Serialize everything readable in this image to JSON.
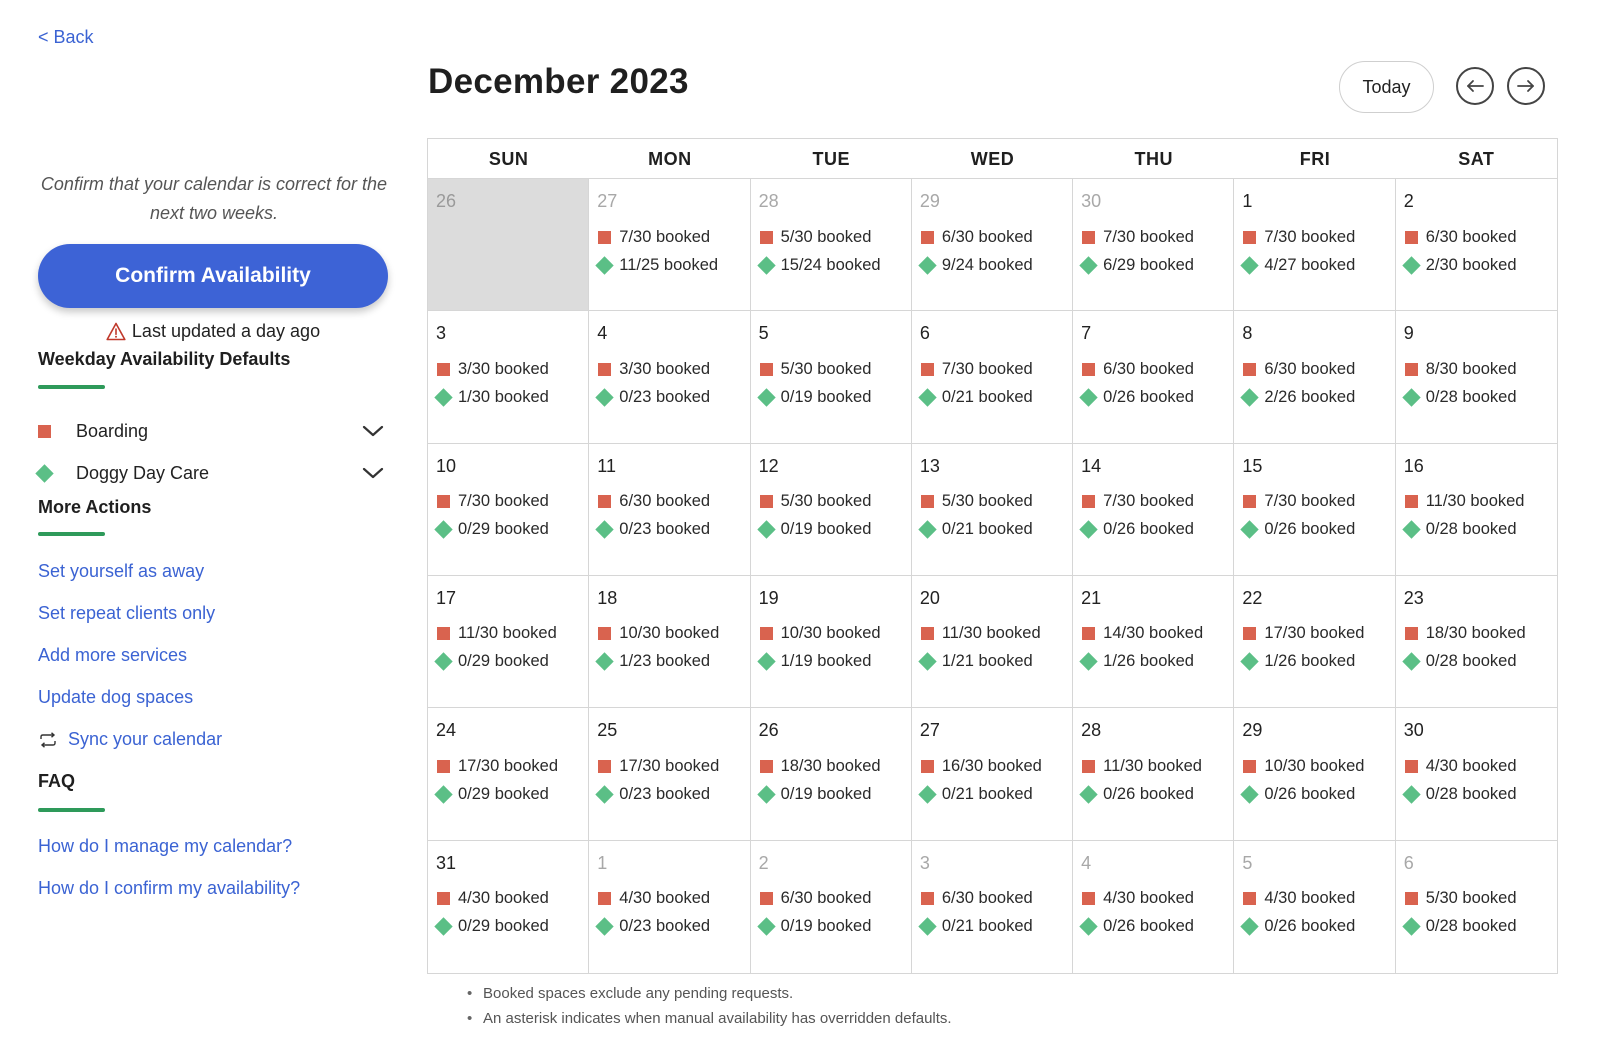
{
  "nav": {
    "back_label": "< Back"
  },
  "sidebar": {
    "confirm_text": "Confirm that your calendar is correct for the next two weeks.",
    "confirm_button": "Confirm Availability",
    "last_updated": "Last updated a day ago",
    "weekday_title": "Weekday Availability Defaults",
    "services": [
      {
        "label": "Boarding",
        "marker": "square",
        "color": "#d9634f"
      },
      {
        "label": "Doggy Day Care",
        "marker": "diamond",
        "color": "#5bbf86"
      }
    ],
    "more_actions_title": "More Actions",
    "actions": [
      {
        "label": "Set yourself as away"
      },
      {
        "label": "Set repeat clients only"
      },
      {
        "label": "Add more services"
      },
      {
        "label": "Update dog spaces"
      },
      {
        "label": "Sync your calendar",
        "icon": "sync-icon"
      }
    ],
    "faq_title": "FAQ",
    "faq_links": [
      {
        "label": "How do I manage my calendar?"
      },
      {
        "label": "How do I confirm my availability?"
      }
    ]
  },
  "calendar": {
    "month_title": "December 2023",
    "today_label": "Today",
    "weekdays": [
      "SUN",
      "MON",
      "TUE",
      "WED",
      "THU",
      "FRI",
      "SAT"
    ],
    "days": [
      {
        "day": "26",
        "other": true,
        "past": true,
        "boarding": "",
        "daycare": ""
      },
      {
        "day": "27",
        "other": true,
        "boarding": "7/30 booked",
        "daycare": "11/25 booked"
      },
      {
        "day": "28",
        "other": true,
        "boarding": "5/30 booked",
        "daycare": "15/24 booked"
      },
      {
        "day": "29",
        "other": true,
        "boarding": "6/30 booked",
        "daycare": "9/24 booked"
      },
      {
        "day": "30",
        "other": true,
        "boarding": "7/30 booked",
        "daycare": "6/29 booked"
      },
      {
        "day": "1",
        "boarding": "7/30 booked",
        "daycare": "4/27 booked"
      },
      {
        "day": "2",
        "boarding": "6/30 booked",
        "daycare": "2/30 booked"
      },
      {
        "day": "3",
        "boarding": "3/30 booked",
        "daycare": "1/30 booked"
      },
      {
        "day": "4",
        "boarding": "3/30 booked",
        "daycare": "0/23 booked"
      },
      {
        "day": "5",
        "boarding": "5/30 booked",
        "daycare": "0/19 booked"
      },
      {
        "day": "6",
        "boarding": "7/30 booked",
        "daycare": "0/21 booked"
      },
      {
        "day": "7",
        "boarding": "6/30 booked",
        "daycare": "0/26 booked"
      },
      {
        "day": "8",
        "boarding": "6/30 booked",
        "daycare": "2/26 booked"
      },
      {
        "day": "9",
        "boarding": "8/30 booked",
        "daycare": "0/28 booked"
      },
      {
        "day": "10",
        "boarding": "7/30 booked",
        "daycare": "0/29 booked"
      },
      {
        "day": "11",
        "boarding": "6/30 booked",
        "daycare": "0/23 booked"
      },
      {
        "day": "12",
        "boarding": "5/30 booked",
        "daycare": "0/19 booked"
      },
      {
        "day": "13",
        "boarding": "5/30 booked",
        "daycare": "0/21 booked"
      },
      {
        "day": "14",
        "boarding": "7/30 booked",
        "daycare": "0/26 booked"
      },
      {
        "day": "15",
        "boarding": "7/30 booked",
        "daycare": "0/26 booked"
      },
      {
        "day": "16",
        "boarding": "11/30 booked",
        "daycare": "0/28 booked"
      },
      {
        "day": "17",
        "boarding": "11/30 booked",
        "daycare": "0/29 booked"
      },
      {
        "day": "18",
        "boarding": "10/30 booked",
        "daycare": "1/23 booked"
      },
      {
        "day": "19",
        "boarding": "10/30 booked",
        "daycare": "1/19 booked"
      },
      {
        "day": "20",
        "boarding": "11/30 booked",
        "daycare": "1/21 booked"
      },
      {
        "day": "21",
        "boarding": "14/30 booked",
        "daycare": "1/26 booked"
      },
      {
        "day": "22",
        "boarding": "17/30 booked",
        "daycare": "1/26 booked"
      },
      {
        "day": "23",
        "boarding": "18/30 booked",
        "daycare": "0/28 booked"
      },
      {
        "day": "24",
        "boarding": "17/30 booked",
        "daycare": "0/29 booked"
      },
      {
        "day": "25",
        "boarding": "17/30 booked",
        "daycare": "0/23 booked"
      },
      {
        "day": "26",
        "boarding": "18/30 booked",
        "daycare": "0/19 booked"
      },
      {
        "day": "27",
        "boarding": "16/30 booked",
        "daycare": "0/21 booked"
      },
      {
        "day": "28",
        "boarding": "11/30 booked",
        "daycare": "0/26 booked"
      },
      {
        "day": "29",
        "boarding": "10/30 booked",
        "daycare": "0/26 booked"
      },
      {
        "day": "30",
        "boarding": "4/30 booked",
        "daycare": "0/28 booked"
      },
      {
        "day": "31",
        "boarding": "4/30 booked",
        "daycare": "0/29 booked"
      },
      {
        "day": "1",
        "other": true,
        "boarding": "4/30 booked",
        "daycare": "0/23 booked"
      },
      {
        "day": "2",
        "other": true,
        "boarding": "6/30 booked",
        "daycare": "0/19 booked"
      },
      {
        "day": "3",
        "other": true,
        "boarding": "6/30 booked",
        "daycare": "0/21 booked"
      },
      {
        "day": "4",
        "other": true,
        "boarding": "4/30 booked",
        "daycare": "0/26 booked"
      },
      {
        "day": "5",
        "other": true,
        "boarding": "4/30 booked",
        "daycare": "0/26 booked"
      },
      {
        "day": "6",
        "other": true,
        "boarding": "5/30 booked",
        "daycare": "0/28 booked"
      }
    ],
    "notes": [
      "Booked spaces exclude any pending requests.",
      "An asterisk indicates when manual availability has overridden defaults."
    ]
  }
}
